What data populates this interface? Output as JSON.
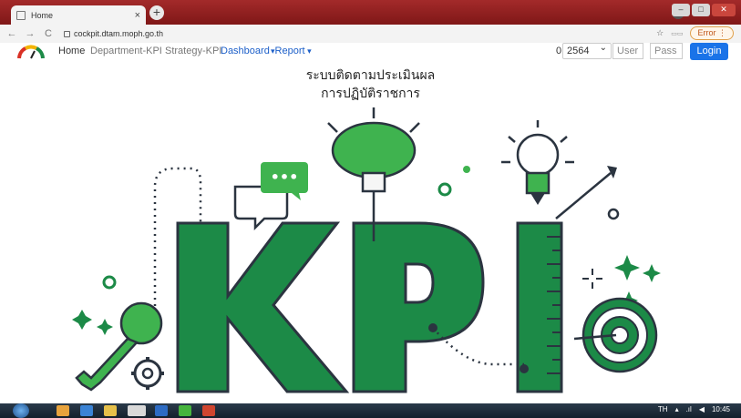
{
  "browser": {
    "tab_title": "Home",
    "tab_close": "×",
    "new_tab": "+",
    "url": "cockpit.dtam.moph.go.th",
    "error_label": "Error"
  },
  "navbar": {
    "home": "Home",
    "department_kpi": "Department-KPI",
    "strategy_kpi": "Strategy-KPI",
    "dashboard": "Dashboard",
    "report": "Report",
    "zero": "0",
    "year": "2564",
    "user_placeholder": "User",
    "password_placeholder": "Pass",
    "login": "Login"
  },
  "hero": {
    "title_line1": "ระบบติดตามประเมินผล",
    "title_line2": "การปฏิบัติราชการ",
    "kpi_text": "KPI",
    "chat_dots": "•••"
  },
  "taskbar": {
    "lang": "TH",
    "time": "10:45"
  },
  "colors": {
    "accent_green": "#1c8a47",
    "light_green": "#3fb34f",
    "dark_outline": "#2b3440",
    "login_blue": "#1a73e8",
    "link_blue": "#1c5fc9"
  }
}
